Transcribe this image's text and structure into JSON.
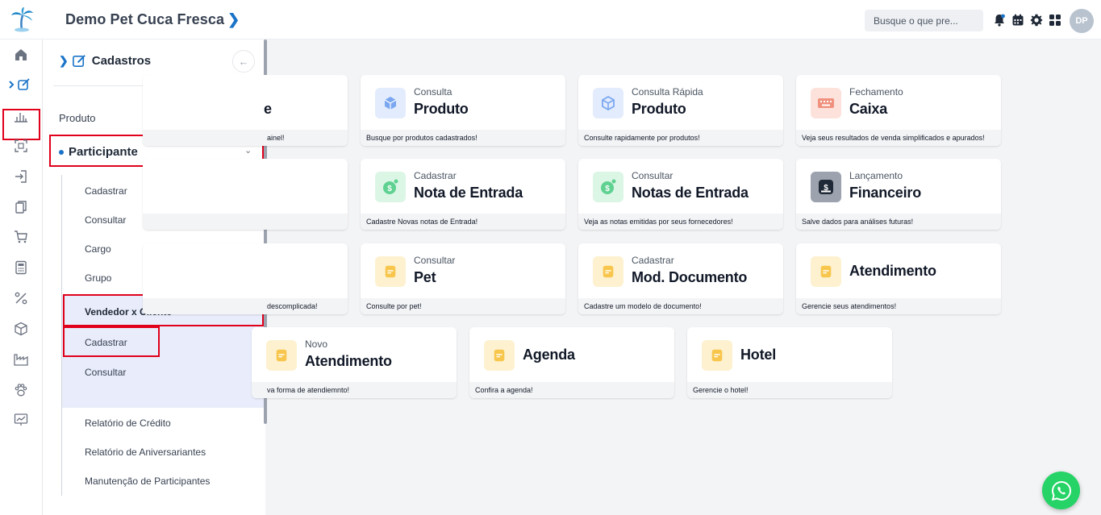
{
  "header": {
    "title": "Demo Pet Cuca Fresca",
    "search_placeholder": "Busque o que pre...",
    "avatar_initials": "DP"
  },
  "panel": {
    "title": "Cadastros",
    "items": {
      "produto": "Produto",
      "participante": "Participante",
      "cadastrar": "Cadastrar",
      "consultar": "Consultar",
      "cargo": "Cargo",
      "grupo": "Grupo",
      "vendedor_cliente": "Vendedor x Cliente",
      "vxc_cadastrar": "Cadastrar",
      "vxc_consultar": "Consultar",
      "relatorio_credito": "Relatório de Crédito",
      "relatorio_aniversariantes": "Relatório de Aniversariantes",
      "manutencao": "Manutenção de Participantes"
    }
  },
  "cards": {
    "c1": {
      "partial_big": "e",
      "foot": "ainel!"
    },
    "c2": {
      "label": "Consulta",
      "big": "Produto",
      "foot": "Busque por produtos cadastrados!"
    },
    "c3": {
      "label": "Consulta Rápida",
      "big": "Produto",
      "foot": "Consulte rapidamente por produtos!"
    },
    "c4": {
      "label": "Fechamento",
      "big": "Caixa",
      "foot": "Veja seus resultados de venda simplificados e apurados!"
    },
    "c5": {
      "foot": ""
    },
    "c6": {
      "label": "Cadastrar",
      "big": "Nota de Entrada",
      "foot": "Cadastre Novas notas de Entrada!"
    },
    "c7": {
      "label": "Consultar",
      "big": "Notas de Entrada",
      "foot": "Veja as notas emitidas por seus fornecedores!"
    },
    "c8": {
      "label": "Lançamento",
      "big": "Financeiro",
      "foot": "Salve dados para análises futuras!"
    },
    "c9": {
      "foot": "descomplicada!"
    },
    "c10": {
      "label": "Consultar",
      "big": "Pet",
      "foot": "Consulte por pet!"
    },
    "c11": {
      "label": "Cadastrar",
      "big": "Mod. Documento",
      "foot": "Cadastre um modelo de documento!"
    },
    "c12": {
      "big": "Atendimento",
      "foot": "Gerencie seus atendimentos!"
    },
    "c13": {
      "label": "Novo",
      "big": "Atendimento",
      "foot": "va forma de atendiemnto!"
    },
    "c14": {
      "big": "Agenda",
      "foot": "Confira a agenda!"
    },
    "c15": {
      "big": "Hotel",
      "foot": "Gerencie o hotel!"
    }
  },
  "colors": {
    "accent": "#1a73c8",
    "highlight": "#e0001b",
    "whatsapp": "#25d366"
  }
}
